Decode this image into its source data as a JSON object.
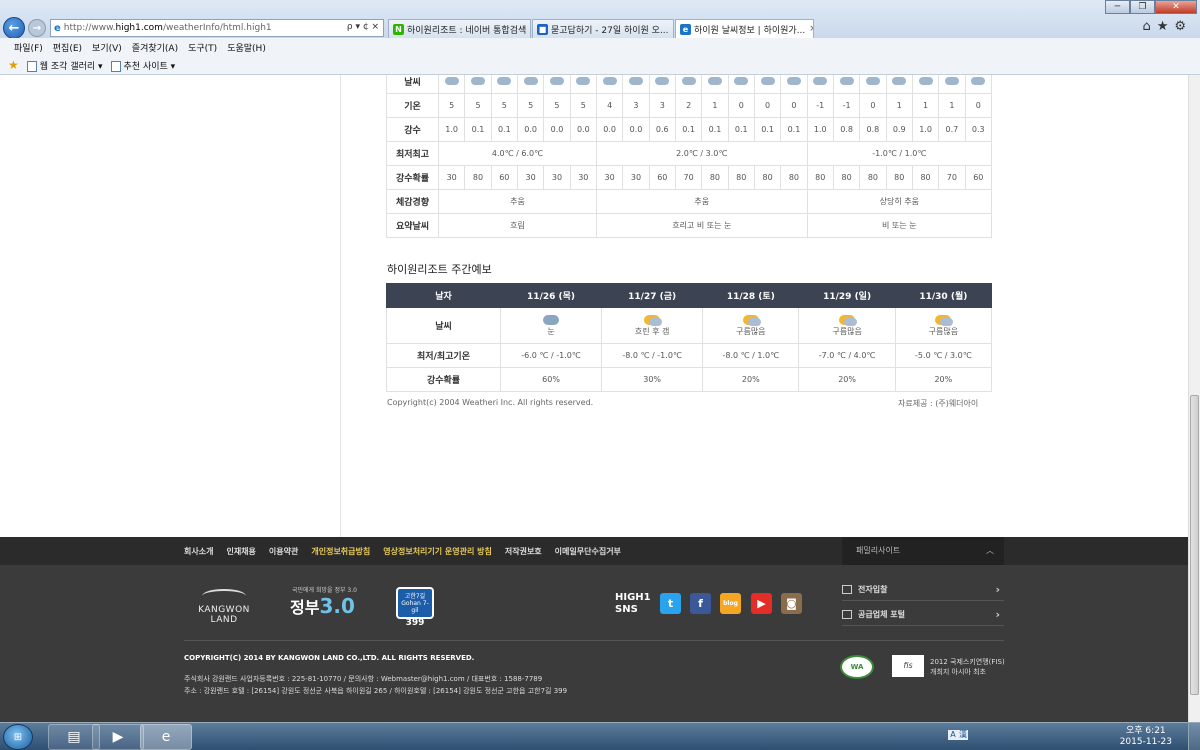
{
  "browser": {
    "url_prefix": "http://www.",
    "url_domain": "high1.com",
    "url_path": "/weatherInfo/html.high1",
    "url_tools": "ρ ▾ ¢ ×",
    "tabs": [
      {
        "label": "하이원리조트 : 네이버 통합검색",
        "icon": "N",
        "icon_color": "#2db400"
      },
      {
        "label": "묻고답하기 - 27일 하이원 오...",
        "icon": "■",
        "icon_color": "#1b63c6"
      },
      {
        "label": "하이원 날씨정보 | 하이원가...",
        "icon": "e",
        "icon_color": "#1a75c9"
      }
    ],
    "tab_close": "×",
    "menu": [
      "파일(F)",
      "편집(E)",
      "보기(V)",
      "즐겨찾기(A)",
      "도구(T)",
      "도움말(H)"
    ],
    "favorites": [
      "웹 조각 갤러리 ▾",
      "추천 사이트 ▾"
    ],
    "right_tools": "⌂★⚙",
    "win_min": "─",
    "win_max": "❐",
    "win_close": "✕"
  },
  "hourly": {
    "row_weather": "날씨",
    "temp_label": "기온",
    "temps": [
      "5",
      "5",
      "5",
      "5",
      "5",
      "5",
      "4",
      "3",
      "3",
      "2",
      "1",
      "0",
      "0",
      "0",
      "-1",
      "-1",
      "0",
      "1",
      "1",
      "1",
      "0"
    ],
    "precip_label": "강수",
    "precips": [
      "1.0",
      "0.1",
      "0.1",
      "0.0",
      "0.0",
      "0.0",
      "0.0",
      "0.0",
      "0.6",
      "0.1",
      "0.1",
      "0.1",
      "0.1",
      "0.1",
      "1.0",
      "0.8",
      "0.8",
      "0.9",
      "1.0",
      "0.7",
      "0.3"
    ],
    "minmax_label": "최저최고",
    "minmax": [
      "4.0℃ / 6.0℃",
      "2.0℃ / 3.0℃",
      "-1.0℃ / 1.0℃"
    ],
    "prob_label": "강수확률",
    "probs": [
      "30",
      "80",
      "60",
      "30",
      "30",
      "30",
      "30",
      "30",
      "60",
      "70",
      "80",
      "80",
      "80",
      "80",
      "80",
      "80",
      "80",
      "80",
      "80",
      "70",
      "60"
    ],
    "feel_label": "체감경향",
    "feels": [
      "추움",
      "추움",
      "상당히 추움"
    ],
    "summary_label": "요약날씨",
    "summaries": [
      "흐림",
      "흐리고 비 또는 눈",
      "비 또는 눈"
    ]
  },
  "weekly": {
    "title": "하이원리조트 주간예보",
    "date_label": "날자",
    "dates": [
      "11/26 (목)",
      "11/27 (금)",
      "11/28 (토)",
      "11/29 (일)",
      "11/30 (월)"
    ],
    "weather_label": "날씨",
    "weathers": [
      {
        "text": "눈",
        "icon": "snow-icon"
      },
      {
        "text": "흐린 후 갬",
        "icon": "cloud-sun-icon"
      },
      {
        "text": "구름많음",
        "icon": "cloud-sun-icon"
      },
      {
        "text": "구름많음",
        "icon": "cloud-sun-icon"
      },
      {
        "text": "구름많음",
        "icon": "cloud-sun-icon"
      }
    ],
    "minmax_label": "최저/최고기온",
    "minmax": [
      "-6.0 ℃ / -1.0℃",
      "-8.0 ℃ / -1.0℃",
      "-8.0 ℃ / 1.0℃",
      "-7.0 ℃ / 4.0℃",
      "-5.0 ℃ / 3.0℃"
    ],
    "prob_label": "강수확률",
    "probs": [
      "60%",
      "30%",
      "20%",
      "20%",
      "20%"
    ]
  },
  "copyright": "Copyright(c) 2004 Weatheri Inc. All rights reserved.",
  "source": "자료제공 : (주)웨더아이",
  "footer": {
    "nav": [
      {
        "label": "회사소개",
        "hl": false
      },
      {
        "label": "인재채용",
        "hl": false
      },
      {
        "label": "이용약관",
        "hl": false
      },
      {
        "label": "개인정보취급방침",
        "hl": true
      },
      {
        "label": "영상정보처리기기 운영관리 방침",
        "hl": true
      },
      {
        "label": "저작권보호",
        "hl": false
      },
      {
        "label": "이메일무단수집거부",
        "hl": false
      }
    ],
    "family_site": "패밀리사이트",
    "kangwon_logo": "KANGWON LAND",
    "gov_small": "국민에게 희망을 정부 3.0",
    "gov_text": "정부",
    "gov_num": "3.0",
    "sign_top": "고한7길 Gohan 7-gil",
    "sign_num": "399",
    "sns_label_1": "HIGH1",
    "sns_label_2": "SNS",
    "links": [
      "전자입찰",
      "공급업체 포털"
    ],
    "copyright": "COPYRIGHT(C) 2014 BY KANGWON LAND CO.,LTD. ALL RIGHTS RESERVED.",
    "addr_line1": "주식회사 강원랜드   사업자등록번호 : 225-81-10770 / 문의사항 : Webmaster@high1.com / 대표번호 : 1588-7789",
    "addr_line2": "주소 : 강원랜드 호텔 : [26154] 강원도 정선군 사북읍 하이원길 265 / 하이원호텔 : [26154] 강원도 정선군 고한읍 고한7길 399",
    "fis_line1": "2012 국제스키연맹(FIS)",
    "fis_line2": "개최지 아시아 최초"
  },
  "taskbar": {
    "clock_time": "오후 6:21",
    "clock_date": "2015-11-23"
  }
}
